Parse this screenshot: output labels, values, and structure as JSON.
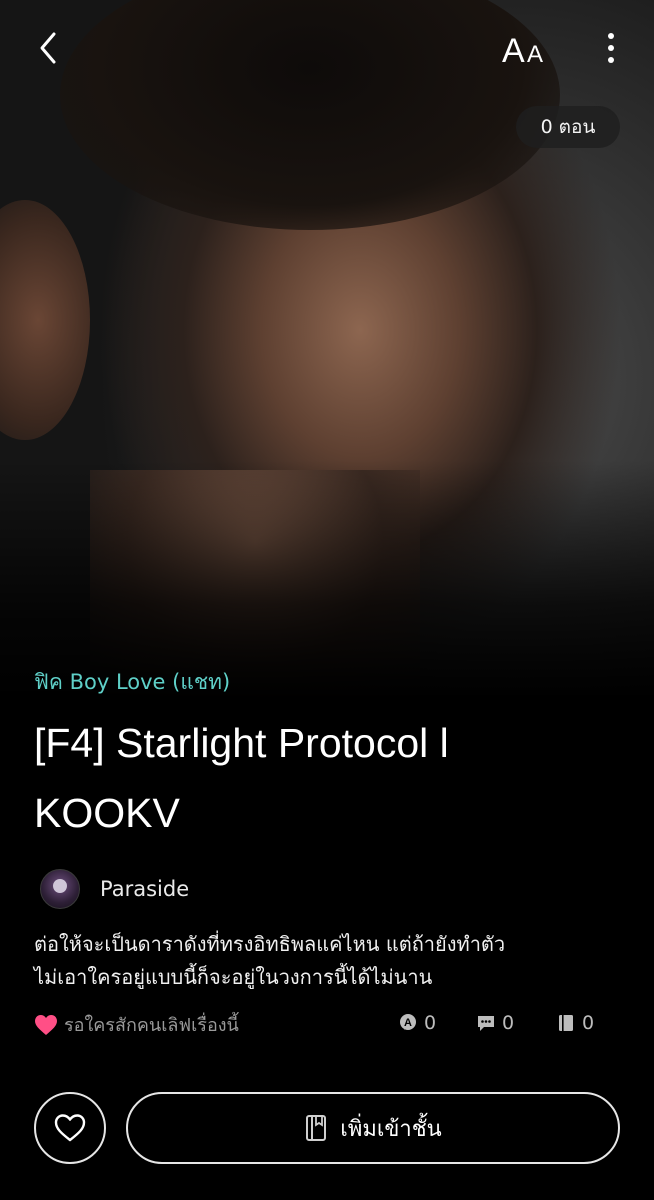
{
  "cover": {
    "badge_count": "0",
    "badge_unit": "ตอน"
  },
  "toolbar": {
    "font_label_big": "A",
    "font_label_small": "A"
  },
  "story": {
    "category": "ฟิค Boy Love (แชท)",
    "title_line1": "[F4] Starlight Protocol l",
    "title_line2": "KOOKV",
    "author": "Paraside",
    "synopsis_line1": "ต่อให้จะเป็นดาราดังที่ทรงอิทธิพลแค่ไหน แต่ถ้ายังทำตัว",
    "synopsis_line2": "ไม่เอาใครอยู่แบบนี้ก็จะอยู่ในวงการนี้ได้ไม่นาน"
  },
  "stats": {
    "like_hint": "รอใครสักคนเลิฟเรื่องนี้",
    "views": "0",
    "comments": "0",
    "shelf": "0"
  },
  "actions": {
    "add_to_shelf": "เพิ่มเข้าชั้น"
  },
  "colors": {
    "accent_category": "#5fd0c8",
    "heart": "#ff4f86"
  }
}
